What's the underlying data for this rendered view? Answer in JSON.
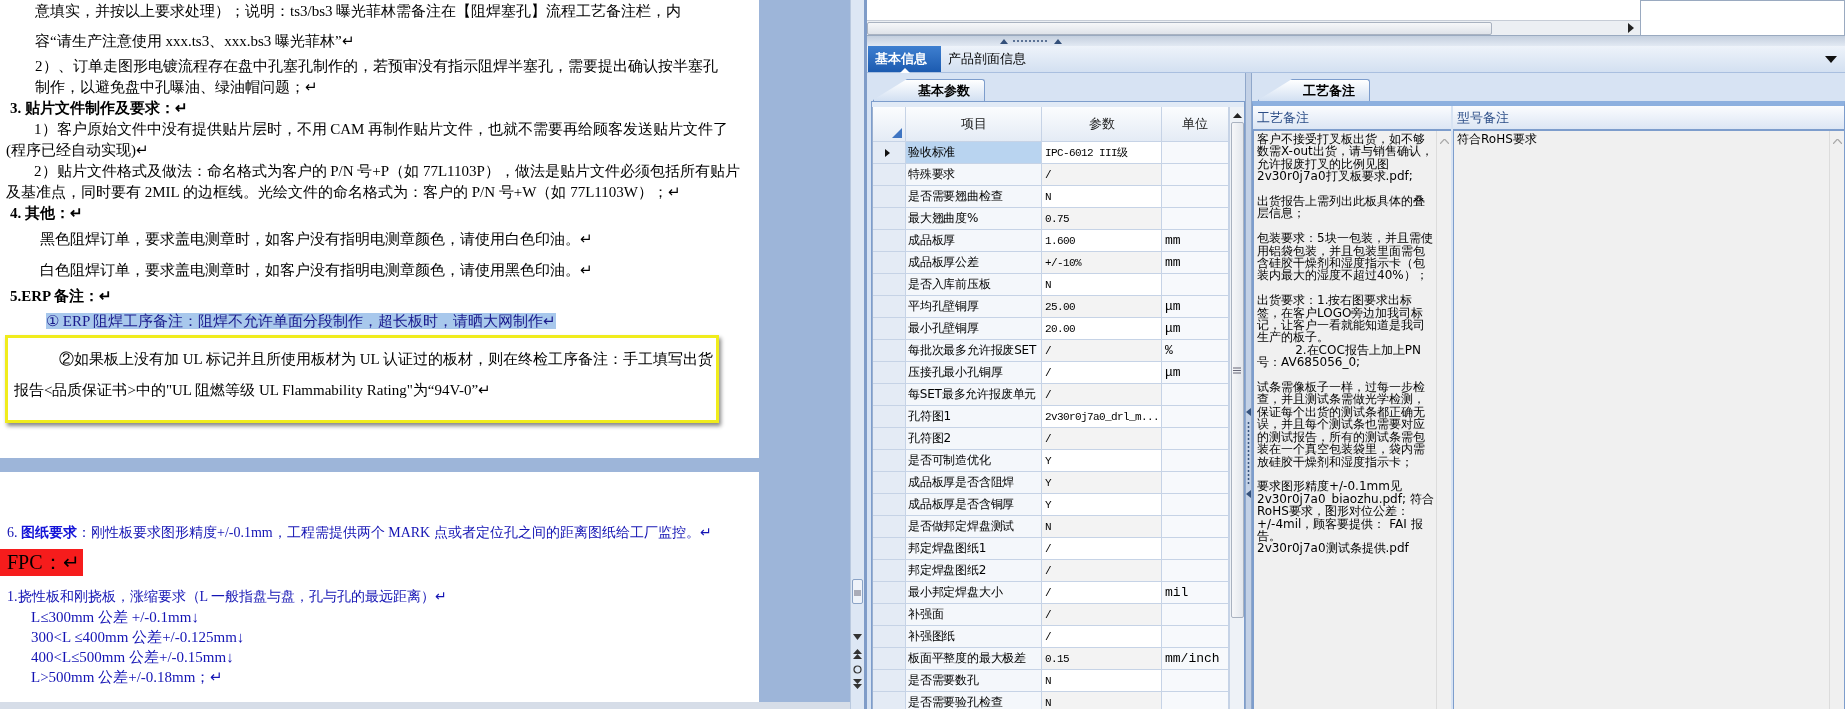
{
  "document": {
    "pages": [
      {
        "paragraphs": [
          {
            "kind": "hanging-spaced",
            "text": "意填实，并按以上要求处理）；说明：ts3/bs3 曝光菲林需备注在【阻焊塞孔】流程工艺备注栏，内容“请生产注意使用 xxx.ts3、xxx.bs3 曝光菲林”↵"
          },
          {
            "kind": "hanging",
            "text": "2）、订单走图形电镀流程存在盘中孔塞孔制作的，若预审没有指示阻焊半塞孔，需要提出确认按半塞孔制作，以避免盘中孔曝油、绿油帽问题；↵"
          },
          {
            "kind": "heading",
            "text": "3. 贴片文件制作及要求：↵"
          },
          {
            "kind": "indent",
            "text": "1）客户原始文件中没有提供贴片层时，不用 CAM 再制作贴片文件，也就不需要再给顾客发送贴片文件了(程序已经自动实现)↵"
          },
          {
            "kind": "indent",
            "text": "2）贴片文件格式及做法：命名格式为客户的 P/N 号+P（如 77L1103P），做法是贴片文件必须包括所有贴片及基准点，同时要有 2MIL 的边框线。光绘文件的命名格式为：客户的 P/N 号+W（如 77L1103W）；↵"
          },
          {
            "kind": "heading",
            "text": "4. 其他：↵"
          },
          {
            "kind": "spaced-indent",
            "text": "黑色阻焊订单，要求盖电测章时，如客户没有指明电测章颜色，请使用白色印油。↵"
          },
          {
            "kind": "spaced-indent",
            "text": "白色阻焊订单，要求盖电测章时，如客户没有指明电测章颜色，请使用黑色印油。↵"
          },
          {
            "kind": "heading",
            "text": "5.ERP 备注：↵"
          },
          {
            "kind": "highlight",
            "text": "① ERP 阻焊工序备注：阻焊不允许单面分段制作，超长板时，请晒大网制作↵"
          },
          {
            "kind": "boxed",
            "text": "②如果板上没有加 UL 标记并且所使用板材为 UL 认证过的板材，则在终检工序备注：手工填写出货报告<品质保证书>中的\"UL 阻燃等级 UL Flammability Rating\"为“94V-0”↵"
          }
        ]
      },
      {
        "paragraphs": [
          {
            "kind": "blue",
            "text": "6. **图纸要求**：刚性板要求图形精度+/-0.1mm，工程需提供两个 MARK 点或者定位孔之间的距离图纸给工厂监控。↵"
          },
          {
            "kind": "label",
            "text": "FPC：↵"
          },
          {
            "kind": "blue",
            "text": "1.挠性板和刚挠板，涨缩要求（L 一般指盘与盘，孔与孔的最远距离）↵"
          },
          {
            "kind": "list",
            "text": "L≤300mm 公差 +/-0.1mm↓"
          },
          {
            "kind": "list",
            "text": "300<L ≤400mm 公差+/-0.125mm↓"
          },
          {
            "kind": "list",
            "text": "400<L≤500mm 公差+/-0.15mm↓"
          },
          {
            "kind": "list",
            "text": "L>500mm 公差+/-0.18mm；↵"
          }
        ]
      }
    ]
  },
  "tabs": [
    {
      "label": "基本信息",
      "selected": true
    },
    {
      "label": "产品剖面信息",
      "selected": false
    }
  ],
  "param_tab": {
    "label": "基本参数"
  },
  "params": {
    "columns": [
      "项目",
      "参数",
      "单位"
    ],
    "rows": [
      {
        "item": "验收标准",
        "value": "IPC-6012 III级",
        "selected": true
      },
      {
        "item": "特殊要求",
        "value": "/",
        "selected": false
      },
      {
        "item": "是否需要翘曲检查",
        "value": "N",
        "selected": false
      },
      {
        "item": "最大翘曲度%",
        "value": "0.75",
        "selected": false
      },
      {
        "item": "成品板厚",
        "value": "1.600",
        "unit": "mm",
        "selected": false
      },
      {
        "item": "成品板厚公差",
        "value": "+/-10%",
        "unit": "mm",
        "selected": false
      },
      {
        "item": "是否入库前压板",
        "value": "N",
        "selected": false
      },
      {
        "item": "平均孔壁铜厚",
        "value": "25.00",
        "unit": "μm",
        "selected": false
      },
      {
        "item": "最小孔壁铜厚",
        "value": "20.00",
        "unit": "μm",
        "selected": false
      },
      {
        "item": "每批次最多允许报废SET",
        "value": "/",
        "unit": "%",
        "selected": false
      },
      {
        "item": "压接孔最小孔铜厚",
        "value": "/",
        "unit": "μm",
        "selected": false
      },
      {
        "item": "每SET最多允许报废单元",
        "value": "/",
        "selected": false
      },
      {
        "item": "孔符图1",
        "value": "2v30r0j7a0_drl_m...",
        "selected": false
      },
      {
        "item": "孔符图2",
        "value": "/",
        "selected": false
      },
      {
        "item": "是否可制造优化",
        "value": "Y",
        "selected": false
      },
      {
        "item": "成品板厚是否含阻焊",
        "value": "Y",
        "selected": false
      },
      {
        "item": "成品板厚是否含铜厚",
        "value": "Y",
        "selected": false
      },
      {
        "item": "是否做邦定焊盘测试",
        "value": "N",
        "selected": false
      },
      {
        "item": "邦定焊盘图纸1",
        "value": "/",
        "selected": false
      },
      {
        "item": "邦定焊盘图纸2",
        "value": "/",
        "selected": false
      },
      {
        "item": "最小邦定焊盘大小",
        "value": "/",
        "unit": "mil",
        "selected": false
      },
      {
        "item": "补强面",
        "value": "/",
        "selected": false
      },
      {
        "item": "补强图纸",
        "value": "/",
        "selected": false
      },
      {
        "item": "板面平整度的最大极差",
        "value": "0.15",
        "unit": "mm/inch",
        "selected": false
      },
      {
        "item": "是否需要数孔",
        "value": "N",
        "selected": false
      },
      {
        "item": "是否需要验孔检查",
        "value": "N",
        "selected": false
      }
    ]
  },
  "notes_tab": {
    "label": "工艺备注"
  },
  "notes": {
    "columns": [
      "工艺备注",
      "型号备注"
    ],
    "process_note": [
      "客户不接受打叉板出货，如不够数需X-out出货，请与销售确认，允许报废打叉的比例见图2v30r0j7a0打叉板要求.pdf;",
      "出货报告上需列出此板具体的叠层信息；",
      "包装要求：5块一包装，并且需使用铝袋包装，并且包装里面需包含硅胶干燥剂和湿度指示卡（包装内最大的湿度不超过40%）；",
      "出货要求：1.按右图要求出标签，在客户LOGO旁边加我司标记，让客户一看就能知道是我司生产的板子。\n          2.在COC报告上加上PN号：AV685056_0;",
      "试条需像板子一样，过每一步检查，并且测试条需做光学检测，保证每个出货的测试条都正确无误，并且每个测试条也需要对应的测试报告，所有的测试条需包装在一个真空包装袋里，袋内需放硅胶干燥剂和湿度指示卡；",
      "要求图形精度+/-0.1mm见2v30r0j7a0_biaozhu.pdf; 符合RoHS要求，图形对位公差：+/-4mil，顾客要提供： FAI 报告。\n2v30r0j7a0测试条提供.pdf"
    ],
    "model_note": "符合RoHS要求"
  }
}
